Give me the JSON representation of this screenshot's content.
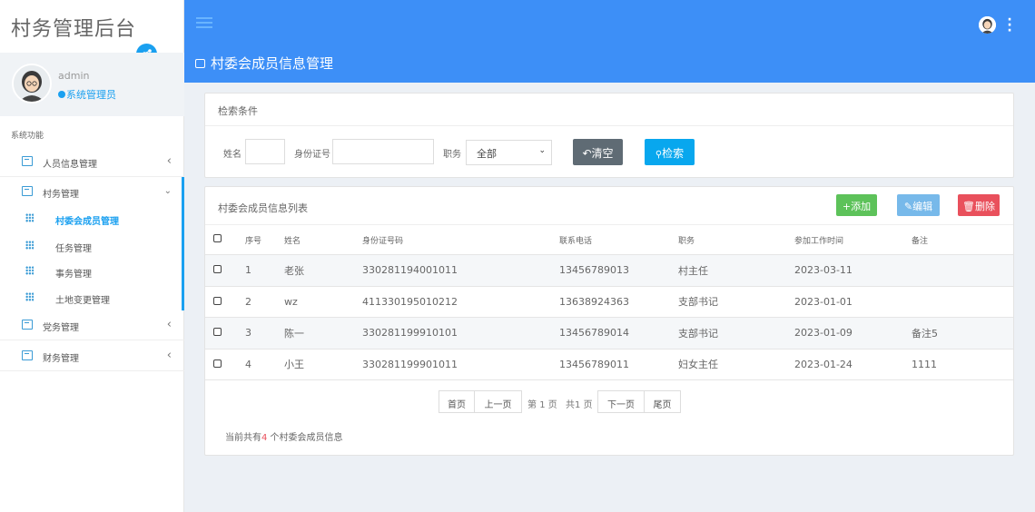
{
  "app": {
    "title": "村务管理后台"
  },
  "profile": {
    "name": "admin",
    "role": "系统管理员"
  },
  "sidebar": {
    "section": "系统功能",
    "items": [
      {
        "label": "人员信息管理",
        "expanded": false
      },
      {
        "label": "村务管理",
        "expanded": true,
        "children": [
          {
            "label": "村委会成员管理",
            "active": true
          },
          {
            "label": "任务管理",
            "active": false
          },
          {
            "label": "事务管理",
            "active": false
          },
          {
            "label": "土地变更管理",
            "active": false
          }
        ]
      },
      {
        "label": "党务管理",
        "expanded": false
      },
      {
        "label": "财务管理",
        "expanded": false
      }
    ]
  },
  "page": {
    "title": "村委会成员信息管理"
  },
  "search": {
    "title": "检索条件",
    "name_label": "姓名",
    "name_value": "",
    "id_label": "身份证号",
    "id_value": "",
    "position_label": "职务",
    "position_value": "全部",
    "clear_label": "清空",
    "search_label": "检索"
  },
  "list": {
    "title": "村委会成员信息列表",
    "add_label": "+添加",
    "edit_label": "编辑",
    "delete_label": "删除",
    "columns": [
      "序号",
      "姓名",
      "身份证号码",
      "联系电话",
      "职务",
      "参加工作时间",
      "备注"
    ],
    "rows": [
      {
        "no": "1",
        "name": "老张",
        "id": "330281194001011",
        "phone": "13456789013",
        "position": "村主任",
        "date": "2023-03-11",
        "note": ""
      },
      {
        "no": "2",
        "name": "wz",
        "id": "411330195010212",
        "phone": "13638924363",
        "position": "支部书记",
        "date": "2023-01-01",
        "note": ""
      },
      {
        "no": "3",
        "name": "陈一",
        "id": "330281199910101",
        "phone": "13456789014",
        "position": "支部书记",
        "date": "2023-01-09",
        "note": "备注5"
      },
      {
        "no": "4",
        "name": "小王",
        "id": "330281199901011",
        "phone": "13456789011",
        "position": "妇女主任",
        "date": "2023-01-24",
        "note": "1111"
      }
    ]
  },
  "pagination": {
    "first": "首页",
    "prev": "上一页",
    "page_prefix": "第",
    "page_current": "1",
    "page_suffix": "页",
    "total_prefix": "共",
    "total_pages": "1",
    "total_suffix": "页",
    "next": "下一页",
    "last": "尾页"
  },
  "summary": {
    "prefix": "当前共有",
    "count": "4",
    "suffix": " 个村委会成员信息"
  },
  "colors": {
    "header_blue": "#3d8ff7",
    "accent_blue": "#1aa0f0",
    "add_green": "#5dc25a",
    "edit_blue": "#77b9ea",
    "delete_red": "#e9505c",
    "clear_gray": "#5f6b74"
  }
}
